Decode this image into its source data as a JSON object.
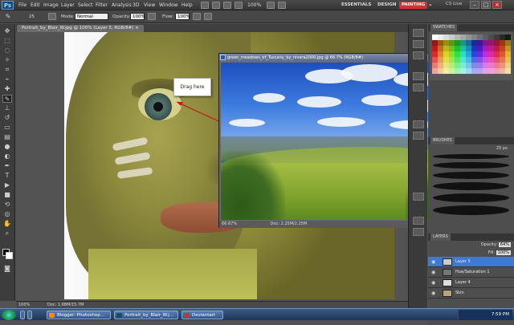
{
  "app": {
    "logo": "Ps",
    "menus": [
      "File",
      "Edit",
      "Image",
      "Layer",
      "Select",
      "Filter",
      "Analysis",
      "3D",
      "View",
      "Window",
      "Help"
    ],
    "zoom": "100%",
    "workspaces": [
      "ESSENTIALS",
      "DESIGN",
      "PAINTING"
    ],
    "active_workspace": "PAINTING",
    "cs_live": "CS Live"
  },
  "options": {
    "brush_size": "25",
    "mode_label": "Mode:",
    "mode_value": "Normal",
    "opacity_label": "Opacity:",
    "opacity_value": "100%",
    "flow_label": "Flow:",
    "flow_value": "100%"
  },
  "document": {
    "tab_title": "Portrait_by_Blair_W.jpg @ 100% (Layer 5, RGB/8#) ×",
    "zoom": "100%",
    "doc_info": "Doc: 1.68M/15.7M",
    "callout_text": "Drag here"
  },
  "second_window": {
    "title": "green_meadows_of_Tuscany_by_nivera2000.jpg @ 66.7% (RGB/8#)",
    "zoom": "66.67%",
    "doc_info": "Doc: 2.25M/2.25M"
  },
  "panels": {
    "swatches_tab": "SWATCHES",
    "brushes_tab": "BRUSHES",
    "brush_size": "25 px",
    "layers_tab": "LAYERS",
    "opacity_label": "Opacity:",
    "opacity_value": "64%",
    "fill_label": "Fill:",
    "fill_value": "100%",
    "layers": [
      {
        "name": "Layer 5",
        "selected": true
      },
      {
        "name": "Hue/Saturation 1",
        "selected": false
      },
      {
        "name": "Layer 4",
        "selected": false
      },
      {
        "name": "Skin",
        "selected": false
      }
    ]
  },
  "taskbar": {
    "items": [
      "Blogger: Photoshop...",
      "Portrait_by_Blair_W.j...",
      "Deviantart"
    ],
    "time": "7:59 PM"
  },
  "colors": {
    "accent": "#c33333",
    "layer_selected": "#3d7ad6",
    "taskbar": "#2a4670"
  }
}
